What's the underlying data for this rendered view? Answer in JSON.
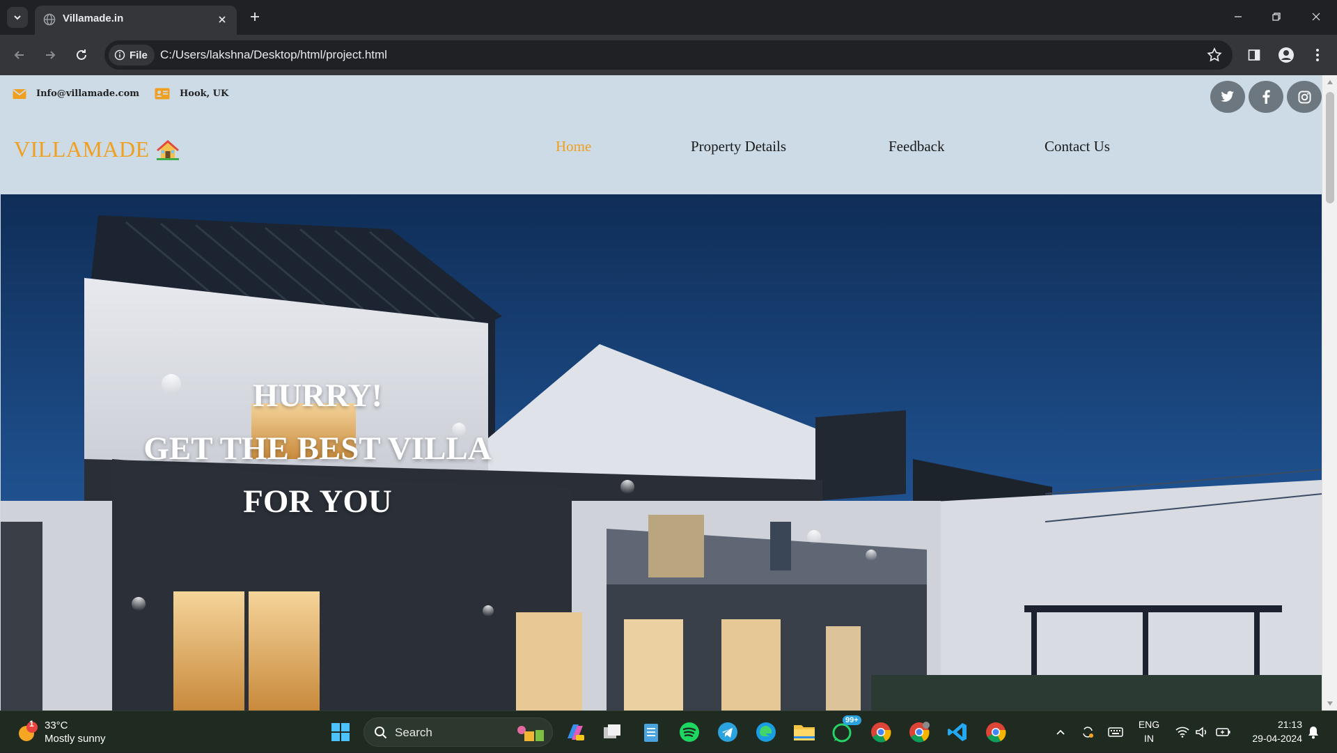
{
  "browser": {
    "tab_title": "Villamade.in",
    "omnibox_chip": "File",
    "url": "C:/Users/lakshna/Desktop/html/project.html"
  },
  "page": {
    "contact": {
      "email": "Info@villamade.com",
      "location": "Hook, UK"
    },
    "brand": "VILLAMADE",
    "brand_emoji": "🏠",
    "nav": [
      {
        "label": "Home",
        "active": true
      },
      {
        "label": "Property Details",
        "active": false
      },
      {
        "label": "Feedback",
        "active": false
      },
      {
        "label": "Contact Us",
        "active": false
      }
    ],
    "socials": [
      "twitter-icon",
      "facebook-icon",
      "instagram-icon"
    ],
    "hero": {
      "line1": "HURRY!",
      "line2": "GET THE BEST VILLA",
      "line3": "FOR YOU"
    },
    "colors": {
      "accent": "#f0a020",
      "header_bg": "#ccdbe6",
      "social_bg": "#6d7780"
    }
  },
  "taskbar": {
    "weather_badge": "1",
    "temperature": "33°C",
    "condition": "Mostly sunny",
    "search_label": "Search",
    "whatsapp_badge": "99+",
    "language_top": "ENG",
    "language_bottom": "IN",
    "time": "21:13",
    "date": "29-04-2024"
  }
}
